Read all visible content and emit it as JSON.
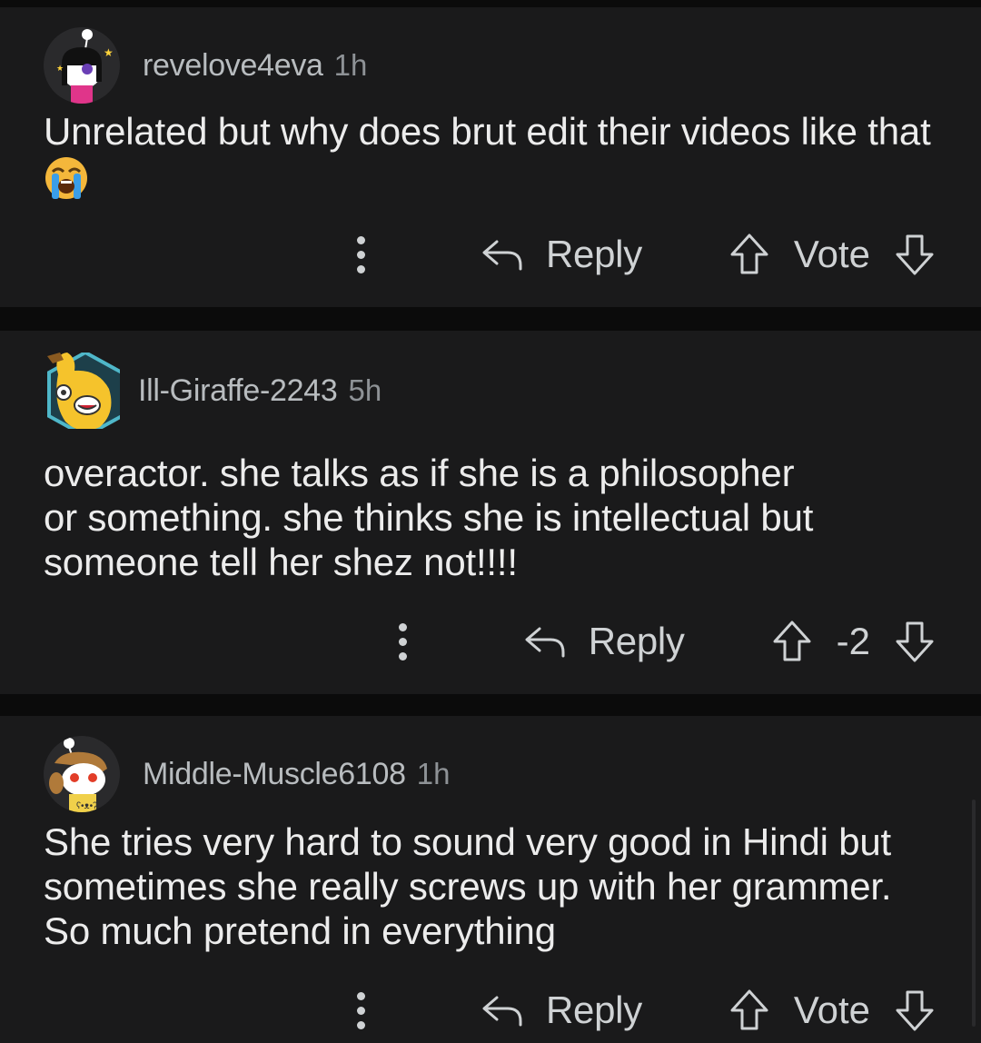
{
  "comments": [
    {
      "username": "revelove4eva",
      "time": "1h",
      "body": "Unrelated but why does brut edit their videos like that",
      "emoji": "loudly-crying-face",
      "reply_label": "Reply",
      "vote_label": "Vote"
    },
    {
      "username": "Ill-Giraffe-2243",
      "time": "5h",
      "body_lines": [
        "overactor. she talks as if she is a philosopher",
        "or something. she thinks she is intellectual but",
        "someone tell her shez not!!!!"
      ],
      "reply_label": "Reply",
      "vote_label": "-2"
    },
    {
      "username": "Middle-Muscle6108",
      "time": "1h",
      "body_lines": [
        "She tries very hard to sound very good in Hindi but",
        "sometimes she really screws up with her grammer.",
        "So much pretend in everything"
      ],
      "reply_label": "Reply",
      "vote_label": "Vote"
    }
  ],
  "icons": {
    "more": "more-options-icon",
    "reply": "reply-arrow-icon",
    "upvote": "upvote-arrow-icon",
    "downvote": "downvote-arrow-icon"
  },
  "colors": {
    "background": "#0b0b0b",
    "card": "#1a1a1b",
    "text": "#ececec",
    "meta": "#b8bcbf"
  }
}
